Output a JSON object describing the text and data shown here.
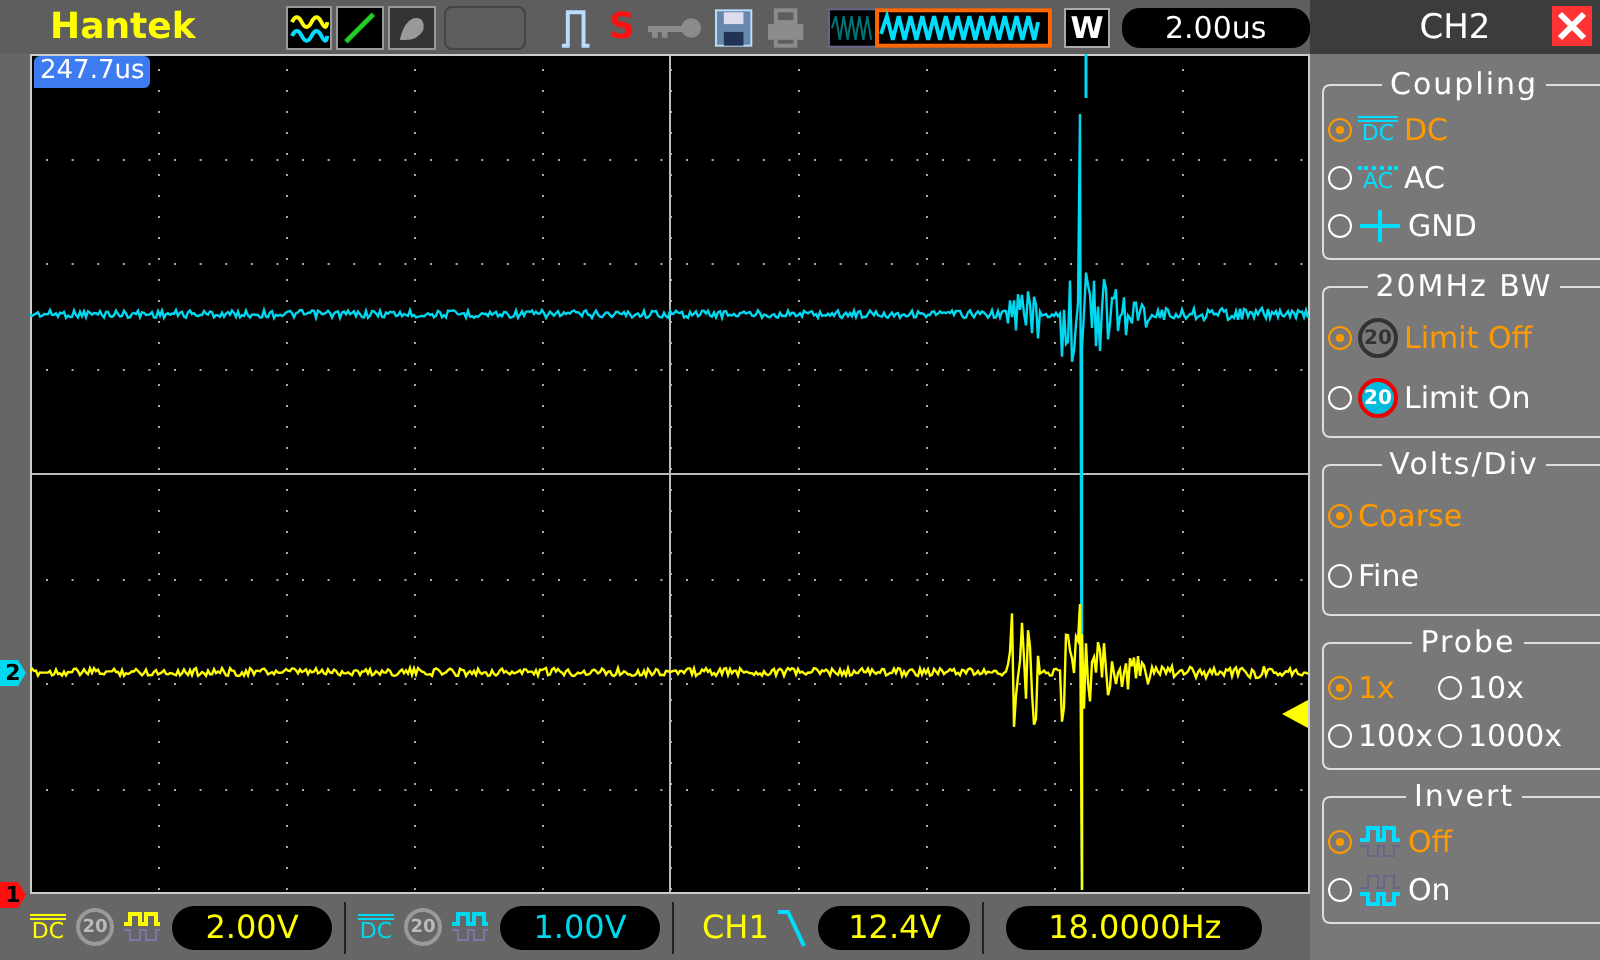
{
  "brand": "Hantek",
  "toolbar": {
    "trigger_status": "S",
    "zoom_label": "W",
    "timebase": "2.00us"
  },
  "screen": {
    "trigger_position": "247.7us",
    "markers": [
      {
        "label": "2",
        "color": "#00d8f0"
      },
      {
        "label": "1",
        "color": "#ff1010"
      }
    ]
  },
  "panel": {
    "title": "CH2",
    "sections": [
      {
        "title": "Coupling",
        "kind": "list",
        "options": [
          {
            "label": "DC",
            "selected": true,
            "kind": "dc",
            "icon_text": "DC"
          },
          {
            "label": "AC",
            "selected": false,
            "kind": "ac",
            "icon_text": "AC"
          },
          {
            "label": "GND",
            "selected": false,
            "kind": "gnd"
          }
        ]
      },
      {
        "title": "20MHz BW",
        "kind": "list",
        "options": [
          {
            "label": "Limit Off",
            "selected": true,
            "kind": "bwoff",
            "icon_text": "20"
          },
          {
            "label": "Limit On",
            "selected": false,
            "kind": "bwon",
            "icon_text": "20"
          }
        ]
      },
      {
        "title": "Volts/Div",
        "kind": "list",
        "options": [
          {
            "label": "Coarse",
            "selected": true,
            "kind": "plain"
          },
          {
            "label": "Fine",
            "selected": false,
            "kind": "plain"
          }
        ]
      },
      {
        "title": "Probe",
        "kind": "grid",
        "options": [
          {
            "label": "1x",
            "selected": true,
            "kind": "plain"
          },
          {
            "label": "10x",
            "selected": false,
            "kind": "plain"
          },
          {
            "label": "100x",
            "selected": false,
            "kind": "plain"
          },
          {
            "label": "1000x",
            "selected": false,
            "kind": "plain"
          }
        ]
      },
      {
        "title": "Invert",
        "kind": "list",
        "options": [
          {
            "label": "Off",
            "selected": true,
            "kind": "normal"
          },
          {
            "label": "On",
            "selected": false,
            "kind": "inverted"
          }
        ]
      }
    ]
  },
  "bottom": {
    "channels": [
      {
        "coupling": "DC",
        "bw": "20",
        "scale": "2.00V",
        "color": "#ffff00"
      },
      {
        "coupling": "DC",
        "bw": "20",
        "scale": "1.00V",
        "color": "#00d8f0"
      }
    ],
    "trigger": {
      "source": "CH1",
      "level": "12.4V"
    },
    "frequency": "18.0000Hz"
  }
}
